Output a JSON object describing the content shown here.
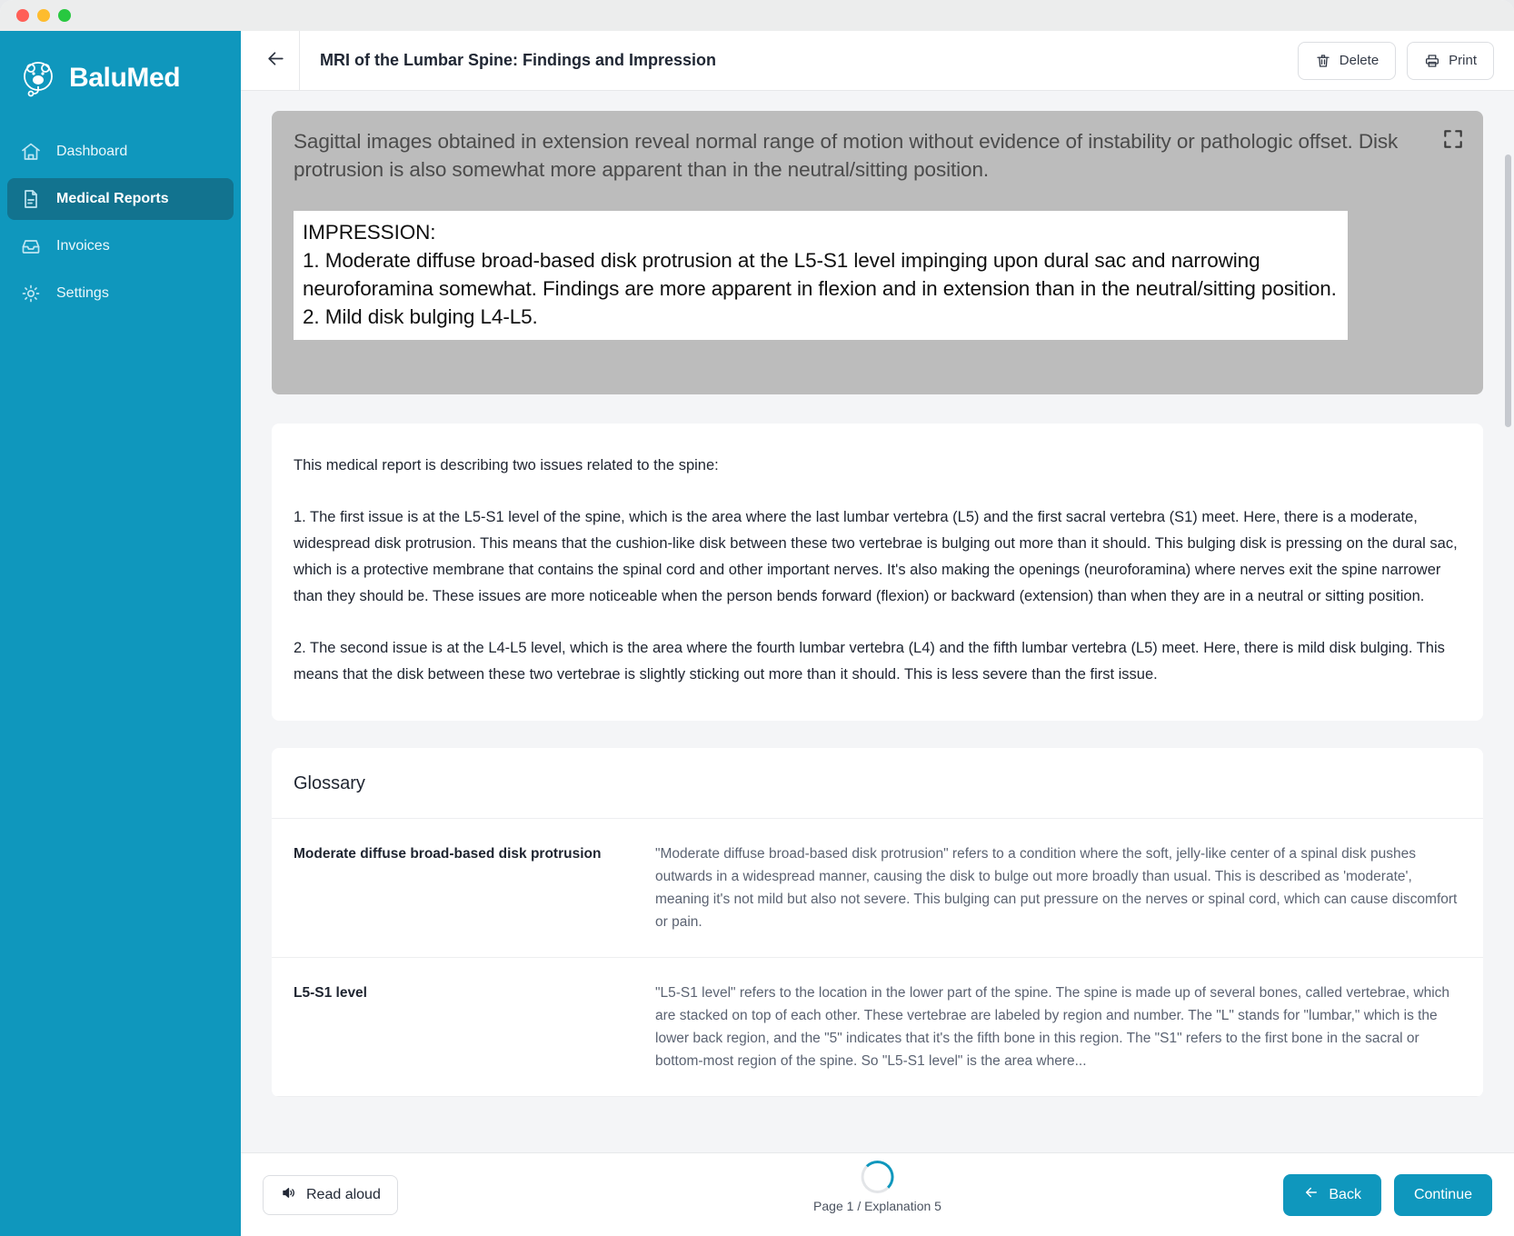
{
  "window": {
    "traffic_lights": [
      "close",
      "minimize",
      "maximize"
    ]
  },
  "sidebar": {
    "brand": "BaluMed",
    "brand_icon": "bear-logo-icon",
    "items": [
      {
        "label": "Dashboard",
        "icon": "home-icon",
        "active": false
      },
      {
        "label": "Medical Reports",
        "icon": "document-icon",
        "active": true
      },
      {
        "label": "Invoices",
        "icon": "inbox-icon",
        "active": false
      },
      {
        "label": "Settings",
        "icon": "gear-icon",
        "active": false
      }
    ]
  },
  "topbar": {
    "back_icon": "arrow-left-icon",
    "title": "MRI of the Lumbar Spine: Findings and Impression",
    "delete_label": "Delete",
    "delete_icon": "trash-icon",
    "print_label": "Print",
    "print_icon": "printer-icon"
  },
  "scan": {
    "expand_icon": "fullscreen-icon",
    "intro": "Sagittal images obtained in extension reveal normal range of motion without evidence of instability or pathologic offset. Disk protrusion is also somewhat more apparent than in the neutral/sitting position.",
    "impression_lines": [
      "IMPRESSION:",
      "1. Moderate diffuse broad-based disk protrusion at the L5-S1 level impinging upon dural sac and narrowing neuroforamina somewhat. Findings are more apparent in flexion and in extension than in the neutral/sitting position.",
      "2. Mild disk bulging L4-L5."
    ]
  },
  "explanation": {
    "paragraphs": [
      "This medical report is describing two issues related to the spine:",
      "1. The first issue is at the L5-S1 level of the spine, which is the area where the last lumbar vertebra (L5) and the first sacral vertebra (S1) meet. Here, there is a moderate, widespread disk protrusion. This means that the cushion-like disk between these two vertebrae is bulging out more than it should. This bulging disk is pressing on the dural sac, which is a protective membrane that contains the spinal cord and other important nerves. It's also making the openings (neuroforamina) where nerves exit the spine narrower than they should be. These issues are more noticeable when the person bends forward (flexion) or backward (extension) than when they are in a neutral or sitting position.",
      "2. The second issue is at the L4-L5 level, which is the area where the fourth lumbar vertebra (L4) and the fifth lumbar vertebra (L5) meet. Here, there is mild disk bulging. This means that the disk between these two vertebrae is slightly sticking out more than it should. This is less severe than the first issue."
    ]
  },
  "glossary": {
    "title": "Glossary",
    "entries": [
      {
        "term": "Moderate diffuse broad-based disk protrusion",
        "definition": "\"Moderate diffuse broad-based disk protrusion\" refers to a condition where the soft, jelly-like center of a spinal disk pushes outwards in a widespread manner, causing the disk to bulge out more broadly than usual. This is described as 'moderate', meaning it's not mild but also not severe. This bulging can put pressure on the nerves or spinal cord, which can cause discomfort or pain."
      },
      {
        "term": "L5-S1 level",
        "definition": "\"L5-S1 level\" refers to the location in the lower part of the spine. The spine is made up of several bones, called vertebrae, which are stacked on top of each other. These vertebrae are labeled by region and number. The \"L\" stands for \"lumbar,\" which is the lower back region, and the \"5\" indicates that it's the fifth bone in this region. The \"S1\" refers to the first bone in the sacral or bottom-most region of the spine. So \"L5-S1 level\" is the area where..."
      }
    ]
  },
  "footer": {
    "read_aloud_label": "Read aloud",
    "read_aloud_icon": "speaker-icon",
    "page_status": "Page 1 / Explanation 5",
    "back_label": "Back",
    "back_icon": "arrow-left-icon",
    "continue_label": "Continue"
  },
  "colors": {
    "brand_teal": "#0f97bd",
    "sidebar_active": "#12738f",
    "page_bg": "#f4f5f7"
  }
}
